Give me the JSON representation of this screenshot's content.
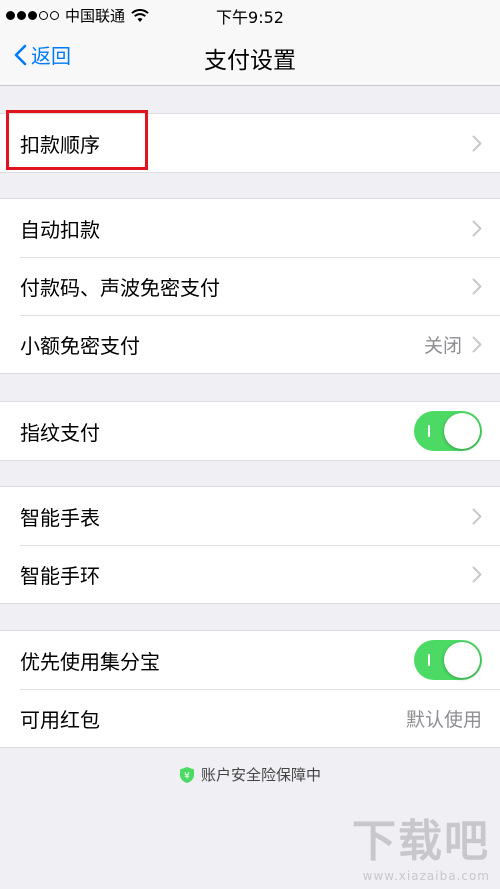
{
  "status_bar": {
    "carrier": "中国联通",
    "time": "下午9:52",
    "signal_full": 3,
    "signal_total": 5
  },
  "nav": {
    "back_label": "返回",
    "title": "支付设置"
  },
  "groups": [
    [
      {
        "label": "扣款顺序",
        "control": "chevron",
        "highlighted": true
      }
    ],
    [
      {
        "label": "自动扣款",
        "control": "chevron"
      },
      {
        "label": "付款码、声波免密支付",
        "control": "chevron"
      },
      {
        "label": "小额免密支付",
        "control": "chevron",
        "value": "关闭"
      }
    ],
    [
      {
        "label": "指纹支付",
        "control": "switch",
        "on": true
      }
    ],
    [
      {
        "label": "智能手表",
        "control": "chevron"
      },
      {
        "label": "智能手环",
        "control": "chevron"
      }
    ],
    [
      {
        "label": "优先使用集分宝",
        "control": "switch",
        "on": true
      },
      {
        "label": "可用红包",
        "control": "value",
        "value": "默认使用"
      }
    ]
  ],
  "footer": {
    "text": "账户安全险保障中",
    "icon": "shield-yen-icon",
    "icon_color": "#4cd964"
  },
  "watermark": {
    "main": "下载吧",
    "sub": "www.xiazaiba.com"
  },
  "colors": {
    "accent": "#007aff",
    "switch_on": "#4cd964",
    "highlight": "#e0141e",
    "background": "#efeff4"
  }
}
